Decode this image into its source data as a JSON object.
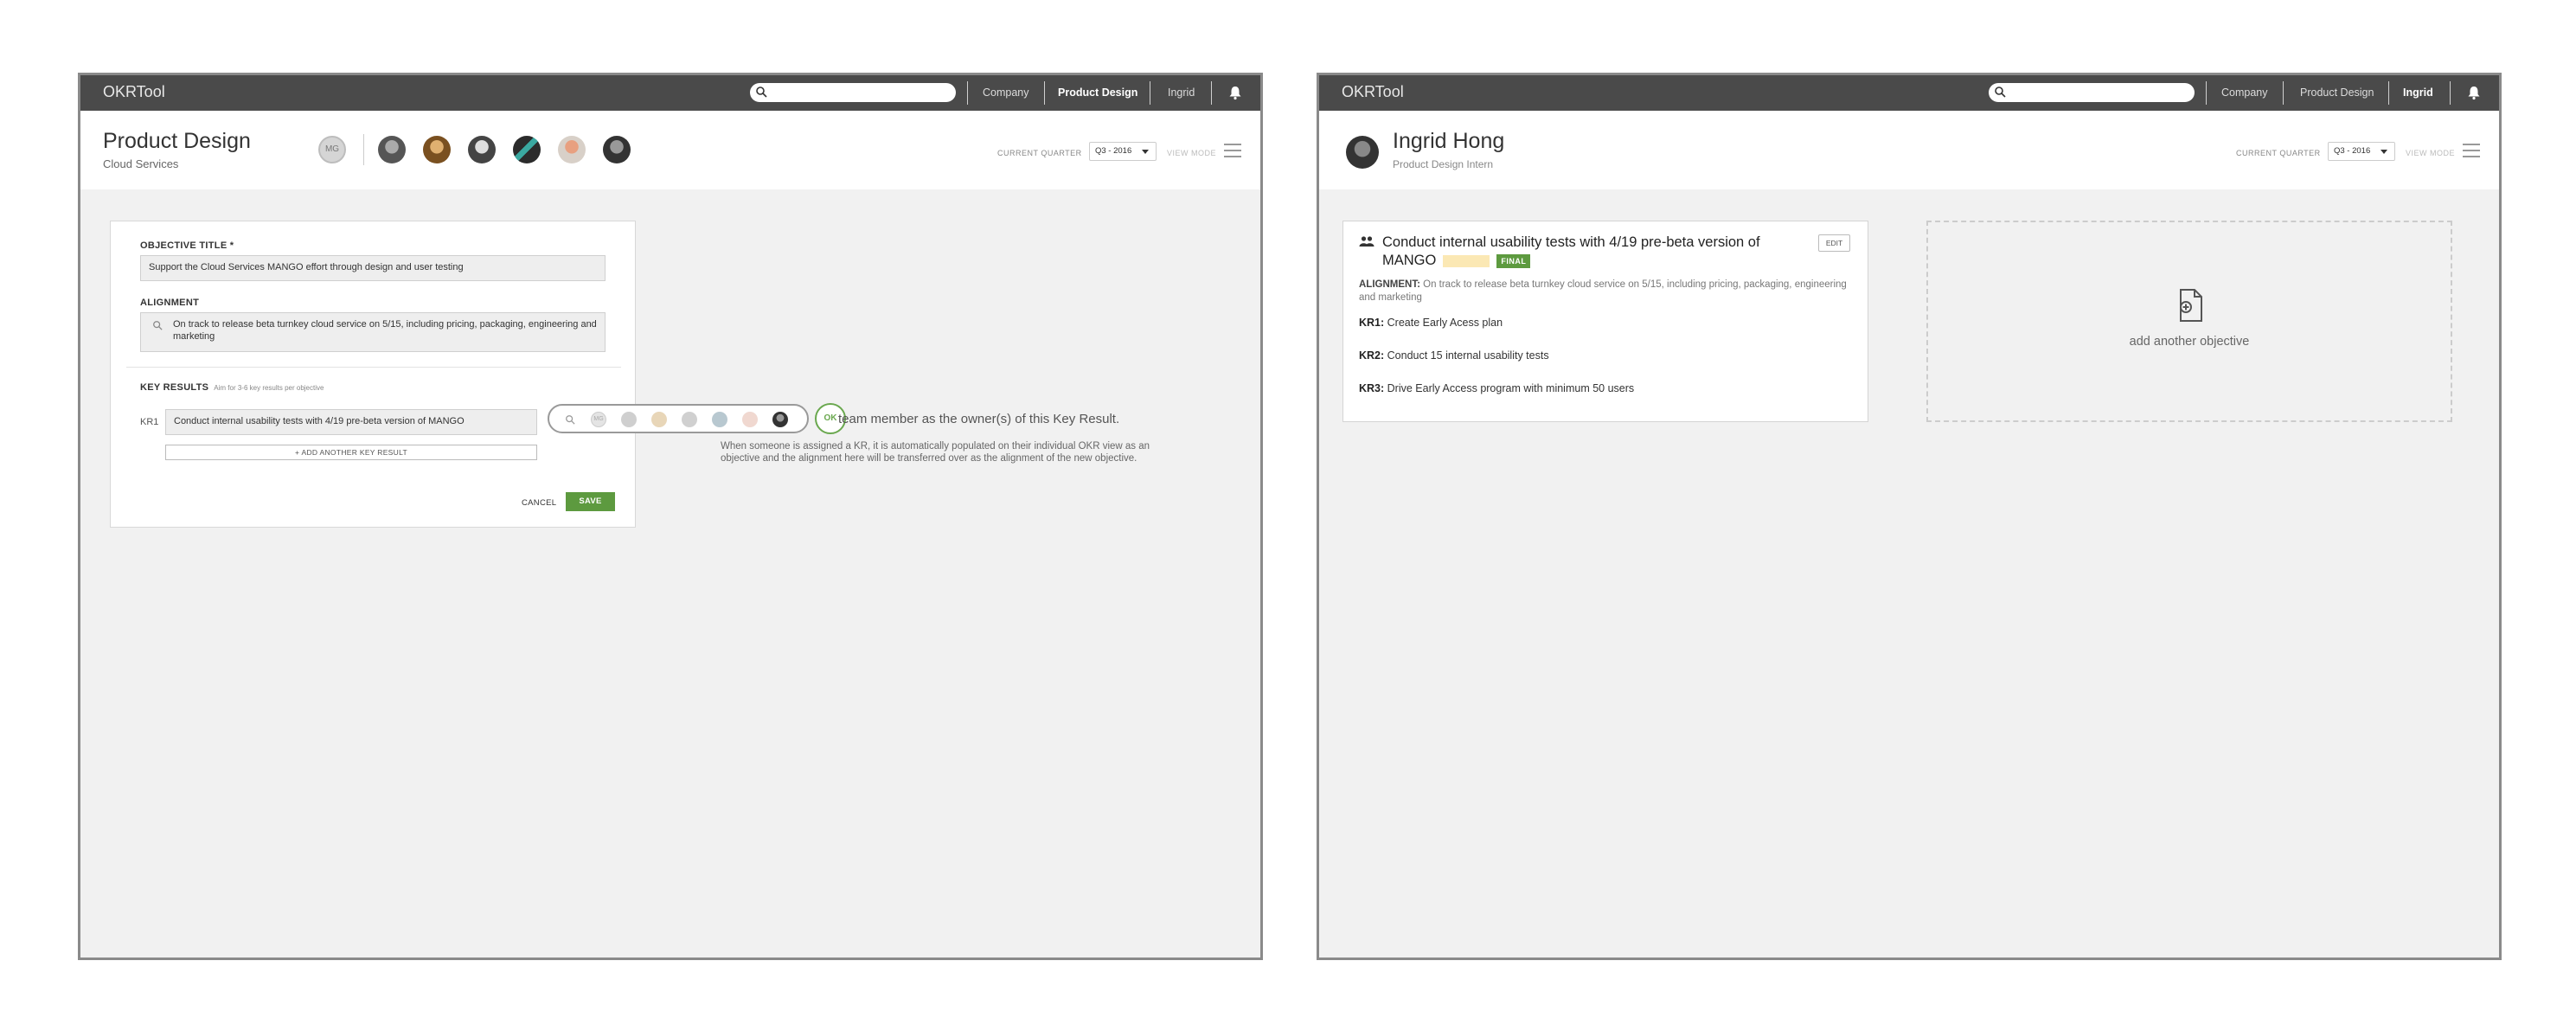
{
  "window1": {
    "brand": "OKRTool",
    "nav": {
      "company": "Company",
      "team": "Product Design",
      "user": "Ingrid"
    },
    "header": {
      "title": "Product Design",
      "subtitle": "Cloud Services",
      "member_initials": "MG"
    },
    "quarter": {
      "label": "CURRENT QUARTER",
      "value": "Q3 - 2016",
      "view_mode": "VIEW MODE"
    },
    "form": {
      "objective_label": "OBJECTIVE TITLE *",
      "objective_value": "Support the Cloud Services MANGO effort through design and user testing",
      "alignment_label": "ALIGNMENT",
      "alignment_value": "On track to release beta turnkey cloud service on 5/15, including pricing, packaging, engineering and marketing",
      "kr_label": "KEY RESULTS",
      "kr_hint": "Aim for 3-6 key results per objective",
      "kr1_label": "KR1",
      "kr1_value": "Conduct internal usability tests with 4/19 pre-beta version of MANGO",
      "add_kr": "+ ADD ANOTHER KEY RESULT",
      "cancel": "CANCEL",
      "save": "SAVE"
    },
    "picker": {
      "initials": "MG",
      "ok": "OK"
    },
    "tooltip": {
      "main": "team member as the owner(s) of this Key Result.",
      "sub": "When someone is assigned a KR, it is automatically populated on their individual OKR view as an objective and the alignment here will be transferred over as the alignment of the new objective."
    }
  },
  "window2": {
    "brand": "OKRTool",
    "nav": {
      "company": "Company",
      "team": "Product Design",
      "user": "Ingrid"
    },
    "header": {
      "title": "Ingrid Hong",
      "subtitle": "Product Design Intern"
    },
    "quarter": {
      "label": "CURRENT QUARTER",
      "value": "Q3 - 2016",
      "view_mode": "VIEW MODE"
    },
    "objective": {
      "title": "Conduct internal usability tests with 4/19 pre-beta version of MANGO",
      "badge": "FINAL",
      "edit": "EDIT",
      "alignment_label": "ALIGNMENT:",
      "alignment_text": "On track to release beta turnkey cloud service on 5/15, including pricing, packaging, engineering and marketing",
      "krs": [
        {
          "label": "KR1:",
          "text": "Create Early Acess plan"
        },
        {
          "label": "KR2:",
          "text": "Conduct 15 internal usability tests"
        },
        {
          "label": "KR3:",
          "text": "Drive Early Access program with minimum 50 users"
        }
      ]
    },
    "add_objective": "add another objective"
  },
  "colors": {
    "topbar": "#4a4a4a",
    "accent_green": "#5d9a3f",
    "background": "#f1f1f1"
  }
}
